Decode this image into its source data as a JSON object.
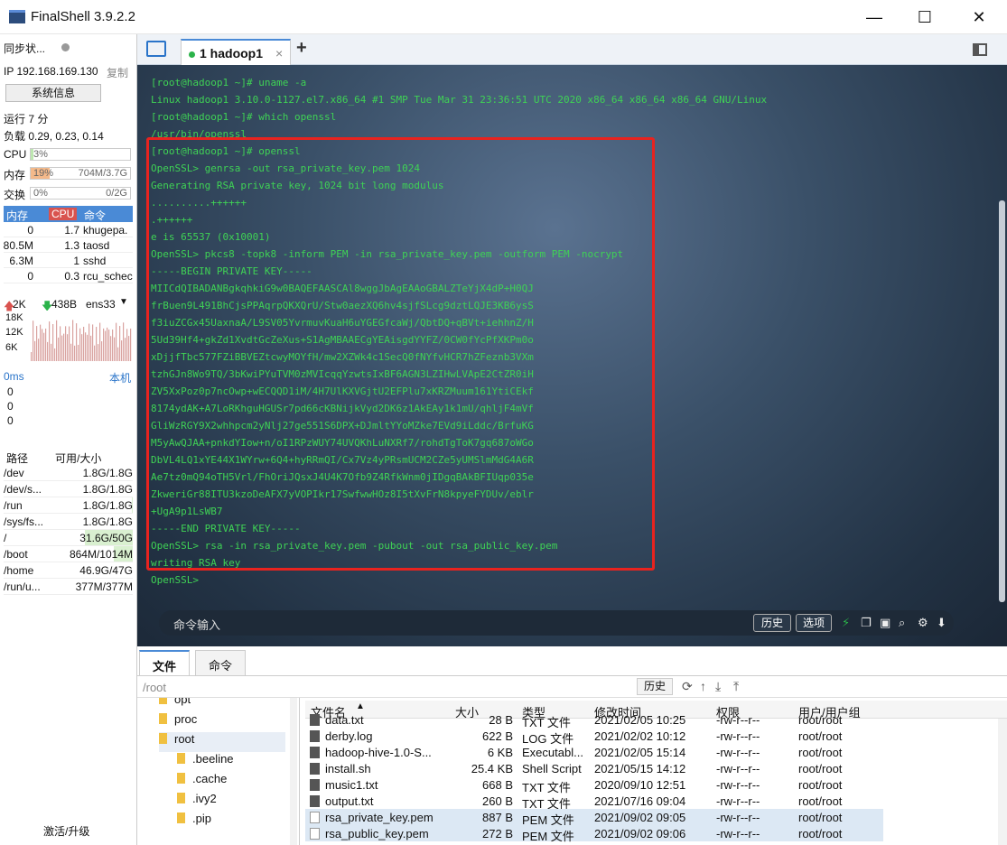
{
  "app": {
    "title": "FinalShell 3.9.2.2",
    "win_min": "—",
    "win_max": "☐",
    "win_close": "✕"
  },
  "left": {
    "sync": "同步状...",
    "ip": "IP 192.168.169.130",
    "copy": "复制",
    "sysinfo_btn": "系统信息",
    "uptime": "运行 7 分",
    "load": "负载 0.29, 0.23, 0.14",
    "cpu_label": "CPU",
    "cpu_pct": "3%",
    "cpu_value": 0.03,
    "mem_label": "内存",
    "mem_pct": "19%",
    "mem_size": "704M/3.7G",
    "mem_value": 0.19,
    "swap_label": "交换",
    "swap_pct": "0%",
    "swap_size": "0/2G",
    "swap_value": 0.0,
    "proc_headers": [
      "内存",
      "CPU",
      "命令"
    ],
    "processes": [
      {
        "mem": "0",
        "cpu": "1.7",
        "cmd": "khugepa."
      },
      {
        "mem": "80.5M",
        "cpu": "1.3",
        "cmd": "taosd"
      },
      {
        "mem": "6.3M",
        "cpu": "1",
        "cmd": "sshd"
      },
      {
        "mem": "0",
        "cpu": "0.3",
        "cmd": "rcu_schec"
      }
    ],
    "net": {
      "up": "2K",
      "down": "438B",
      "iface": "ens33",
      "y_ticks": [
        "18K",
        "12K",
        "6K"
      ]
    },
    "latency": {
      "ms": "0ms",
      "host": "本机",
      "vals": [
        "0",
        "0",
        "0"
      ]
    },
    "disk_headers": [
      "路径",
      "可用/大小"
    ],
    "disks": [
      {
        "path": "/dev",
        "size": "1.8G/1.8G",
        "used": 0.0
      },
      {
        "path": "/dev/s...",
        "size": "1.8G/1.8G",
        "used": 0.0
      },
      {
        "path": "/run",
        "size": "1.8G/1.8G",
        "used": 0.01
      },
      {
        "path": "/sys/fs...",
        "size": "1.8G/1.8G",
        "used": 0.0
      },
      {
        "path": "/",
        "size": "31.6G/50G",
        "used": 0.37
      },
      {
        "path": "/boot",
        "size": "864M/1014M",
        "used": 0.15
      },
      {
        "path": "/home",
        "size": "46.9G/47G",
        "used": 0.0
      },
      {
        "path": "/run/u...",
        "size": "377M/377M",
        "used": 0.0
      }
    ],
    "activate": "激活/升级"
  },
  "tab": {
    "label": "1 hadoop1",
    "close": "×",
    "add": "+"
  },
  "terminal": {
    "lines": [
      "[root@hadoop1 ~]# uname -a",
      "Linux hadoop1 3.10.0-1127.el7.x86_64 #1 SMP Tue Mar 31 23:36:51 UTC 2020 x86_64 x86_64 x86_64 GNU/Linux",
      "[root@hadoop1 ~]# which openssl",
      "/usr/bin/openssl",
      "[root@hadoop1 ~]# openssl",
      "OpenSSL> genrsa -out rsa_private_key.pem 1024",
      "Generating RSA private key, 1024 bit long modulus",
      "..........++++++",
      ".++++++",
      "e is 65537 (0x10001)",
      "OpenSSL> pkcs8 -topk8 -inform PEM -in rsa_private_key.pem -outform PEM -nocrypt",
      "-----BEGIN PRIVATE KEY-----",
      "MIICdQIBADANBgkqhkiG9w0BAQEFAASCAl8wggJbAgEAAoGBALZTeYjX4dP+H0QJ",
      "frBuen9L491BhCjsPPAqrpQKXQrU/Stw0aezXQ6hv4sjfSLcg9dztLQJE3KB6ysS",
      "f3iuZCGx45UaxnaA/L9SV05YvrmuvKuaH6uYGEGfcaWj/QbtDQ+qBVt+iehhnZ/H",
      "5Ud39Hf4+gkZd1XvdtGcZeXus+S1AgMBAAECgYEAisgdYYFZ/0CW0fYcPfXKPm0o",
      "xDjjfTbc577FZiBBVEZtcwyMOYfH/mw2XZWk4c1SecQ0fNYfvHCR7hZFeznb3VXm",
      "tzhGJn8Wo9TQ/3bKwiPYuTVM0zMVIcqqYzwtsIxBF6AGN3LZIHwLVApE2CtZR0iH",
      "ZV5XxPoz0p7ncOwp+wECQQD1iM/4H7UlKXVGjtU2EFPlu7xKRZMuum161YtiCEkf",
      "8174ydAK+A7LoRKhguHGUSr7pd66cKBNijkVyd2DK6z1AkEAy1k1mU/qhljF4mVf",
      "GliWzRGY9X2whhpcm2yNlj27ge551S6DPX+DJmltYYoMZke7EVd9iLddc/BrfuKG",
      "M5yAwQJAA+pnkdYIow+n/oI1RPzWUY74UVQKhLuNXRf7/rohdTgToK7gq687oWGo",
      "DbVL4LQ1xYE44X1WYrw+6Q4+hyRRmQI/Cx7Vz4yPRsmUCM2CZe5yUMSlmMdG4A6R",
      "Ae7tz0mQ94oTH5Vrl/FhOriJQsxJ4U4K7Ofb9Z4RfkWnm0jIDgqBAkBFIUqp035e",
      "ZkweriGr88ITU3kzoDeAFX7yVOPIkr17SwfwwHOz8I5tXvFrN8kpyeFYDUv/eblr",
      "+UgA9p1LsWB7",
      "-----END PRIVATE KEY-----",
      "OpenSSL> rsa -in rsa_private_key.pem -pubout -out rsa_public_key.pem",
      "writing RSA key",
      "OpenSSL>"
    ]
  },
  "cmdbar": {
    "label": "命令输入",
    "history": "历史",
    "options": "选项"
  },
  "filepanel": {
    "tab_files": "文件",
    "tab_cmd": "命令",
    "path": "/root",
    "history": "历史",
    "tree": [
      {
        "name": "opt",
        "indent": 0
      },
      {
        "name": "proc",
        "indent": 0
      },
      {
        "name": "root",
        "indent": 0
      },
      {
        "name": ".beeline",
        "indent": 1
      },
      {
        "name": ".cache",
        "indent": 1
      },
      {
        "name": ".ivy2",
        "indent": 1
      },
      {
        "name": ".pip",
        "indent": 1
      }
    ],
    "headers": [
      "文件名",
      "大小",
      "类型",
      "修改时间",
      "权限",
      "用户/用户组"
    ],
    "files": [
      {
        "name": "data.txt",
        "size": "28 B",
        "type": "TXT 文件",
        "mtime": "2021/02/05 10:25",
        "perm": "-rw-r--r--",
        "owner": "root/root",
        "icon": "txt"
      },
      {
        "name": "derby.log",
        "size": "622 B",
        "type": "LOG 文件",
        "mtime": "2021/02/02 10:12",
        "perm": "-rw-r--r--",
        "owner": "root/root",
        "icon": "txt"
      },
      {
        "name": "hadoop-hive-1.0-S...",
        "size": "6 KB",
        "type": "Executabl...",
        "mtime": "2021/02/05 15:14",
        "perm": "-rw-r--r--",
        "owner": "root/root",
        "icon": "exe"
      },
      {
        "name": "install.sh",
        "size": "25.4 KB",
        "type": "Shell Script",
        "mtime": "2021/05/15 14:12",
        "perm": "-rw-r--r--",
        "owner": "root/root",
        "icon": "sh"
      },
      {
        "name": "music1.txt",
        "size": "668 B",
        "type": "TXT 文件",
        "mtime": "2020/09/10 12:51",
        "perm": "-rw-r--r--",
        "owner": "root/root",
        "icon": "txt"
      },
      {
        "name": "output.txt",
        "size": "260 B",
        "type": "TXT 文件",
        "mtime": "2021/07/16 09:04",
        "perm": "-rw-r--r--",
        "owner": "root/root",
        "icon": "txt"
      },
      {
        "name": "rsa_private_key.pem",
        "size": "887 B",
        "type": "PEM 文件",
        "mtime": "2021/09/02 09:05",
        "perm": "-rw-r--r--",
        "owner": "root/root",
        "icon": "pem",
        "selected": true
      },
      {
        "name": "rsa_public_key.pem",
        "size": "272 B",
        "type": "PEM 文件",
        "mtime": "2021/09/02 09:06",
        "perm": "-rw-r--r--",
        "owner": "root/root",
        "icon": "pem",
        "selected": true
      }
    ]
  },
  "colors": {
    "terminal_text": "#3fd255",
    "highlight_box": "#e8231f",
    "accent": "#4a8ad6"
  }
}
